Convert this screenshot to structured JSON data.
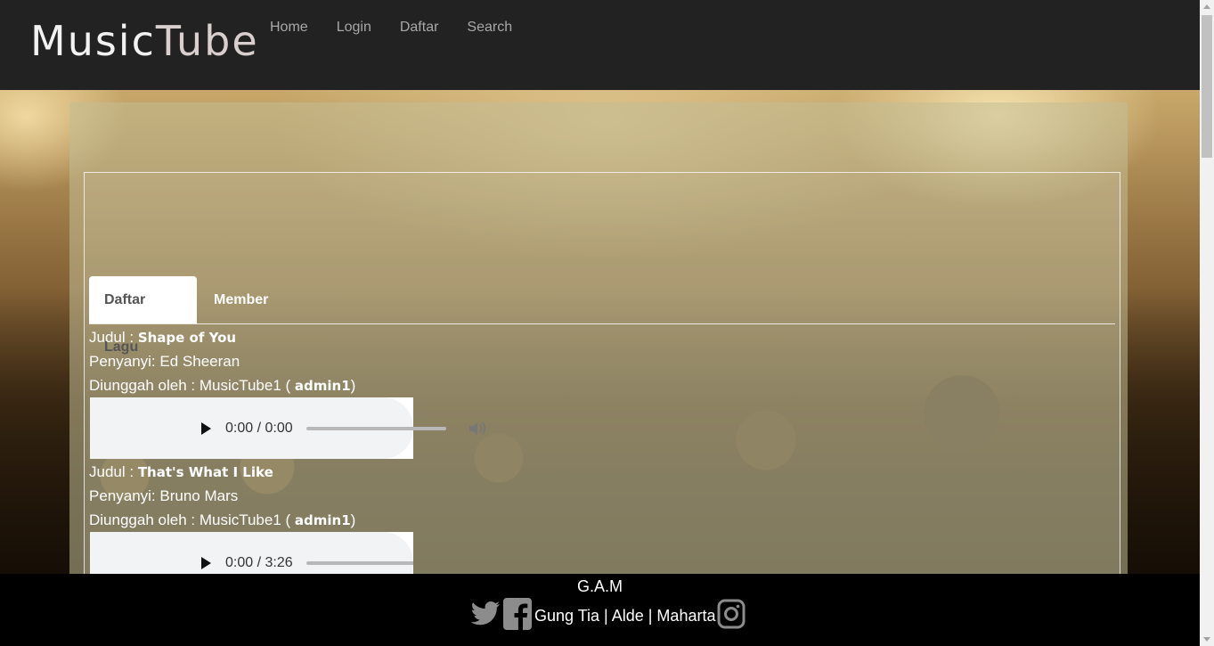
{
  "header": {
    "logo_part1": "Music",
    "logo_part2": "Tube",
    "nav": [
      "Home",
      "Login",
      "Daftar",
      "Search"
    ]
  },
  "tabs": [
    "Daftar Lagu",
    "Member"
  ],
  "labels": {
    "judul": "Judul : ",
    "penyanyi": "Penyanyi: ",
    "diunggah": "Diunggah oleh : ",
    "open_paren": " ( ",
    "close_paren": ")"
  },
  "songs": [
    {
      "title": "Shape of You",
      "artist": "Ed Sheeran",
      "uploader": "MusicTube1",
      "username": "admin1",
      "time": "0:00 / 0:00"
    },
    {
      "title": "That's What I Like",
      "artist": "Bruno Mars",
      "uploader": "MusicTube1",
      "username": "admin1",
      "time": "0:00 / 3:26"
    }
  ],
  "footer": {
    "brand": "G.A.M",
    "names": "Gung Tia | Alde | Maharta"
  },
  "icons": {
    "play": "play-icon",
    "volume": "volume-icon",
    "more": "more-vertical-icon",
    "twitter": "twitter-icon",
    "facebook": "facebook-icon",
    "instagram": "instagram-icon"
  }
}
